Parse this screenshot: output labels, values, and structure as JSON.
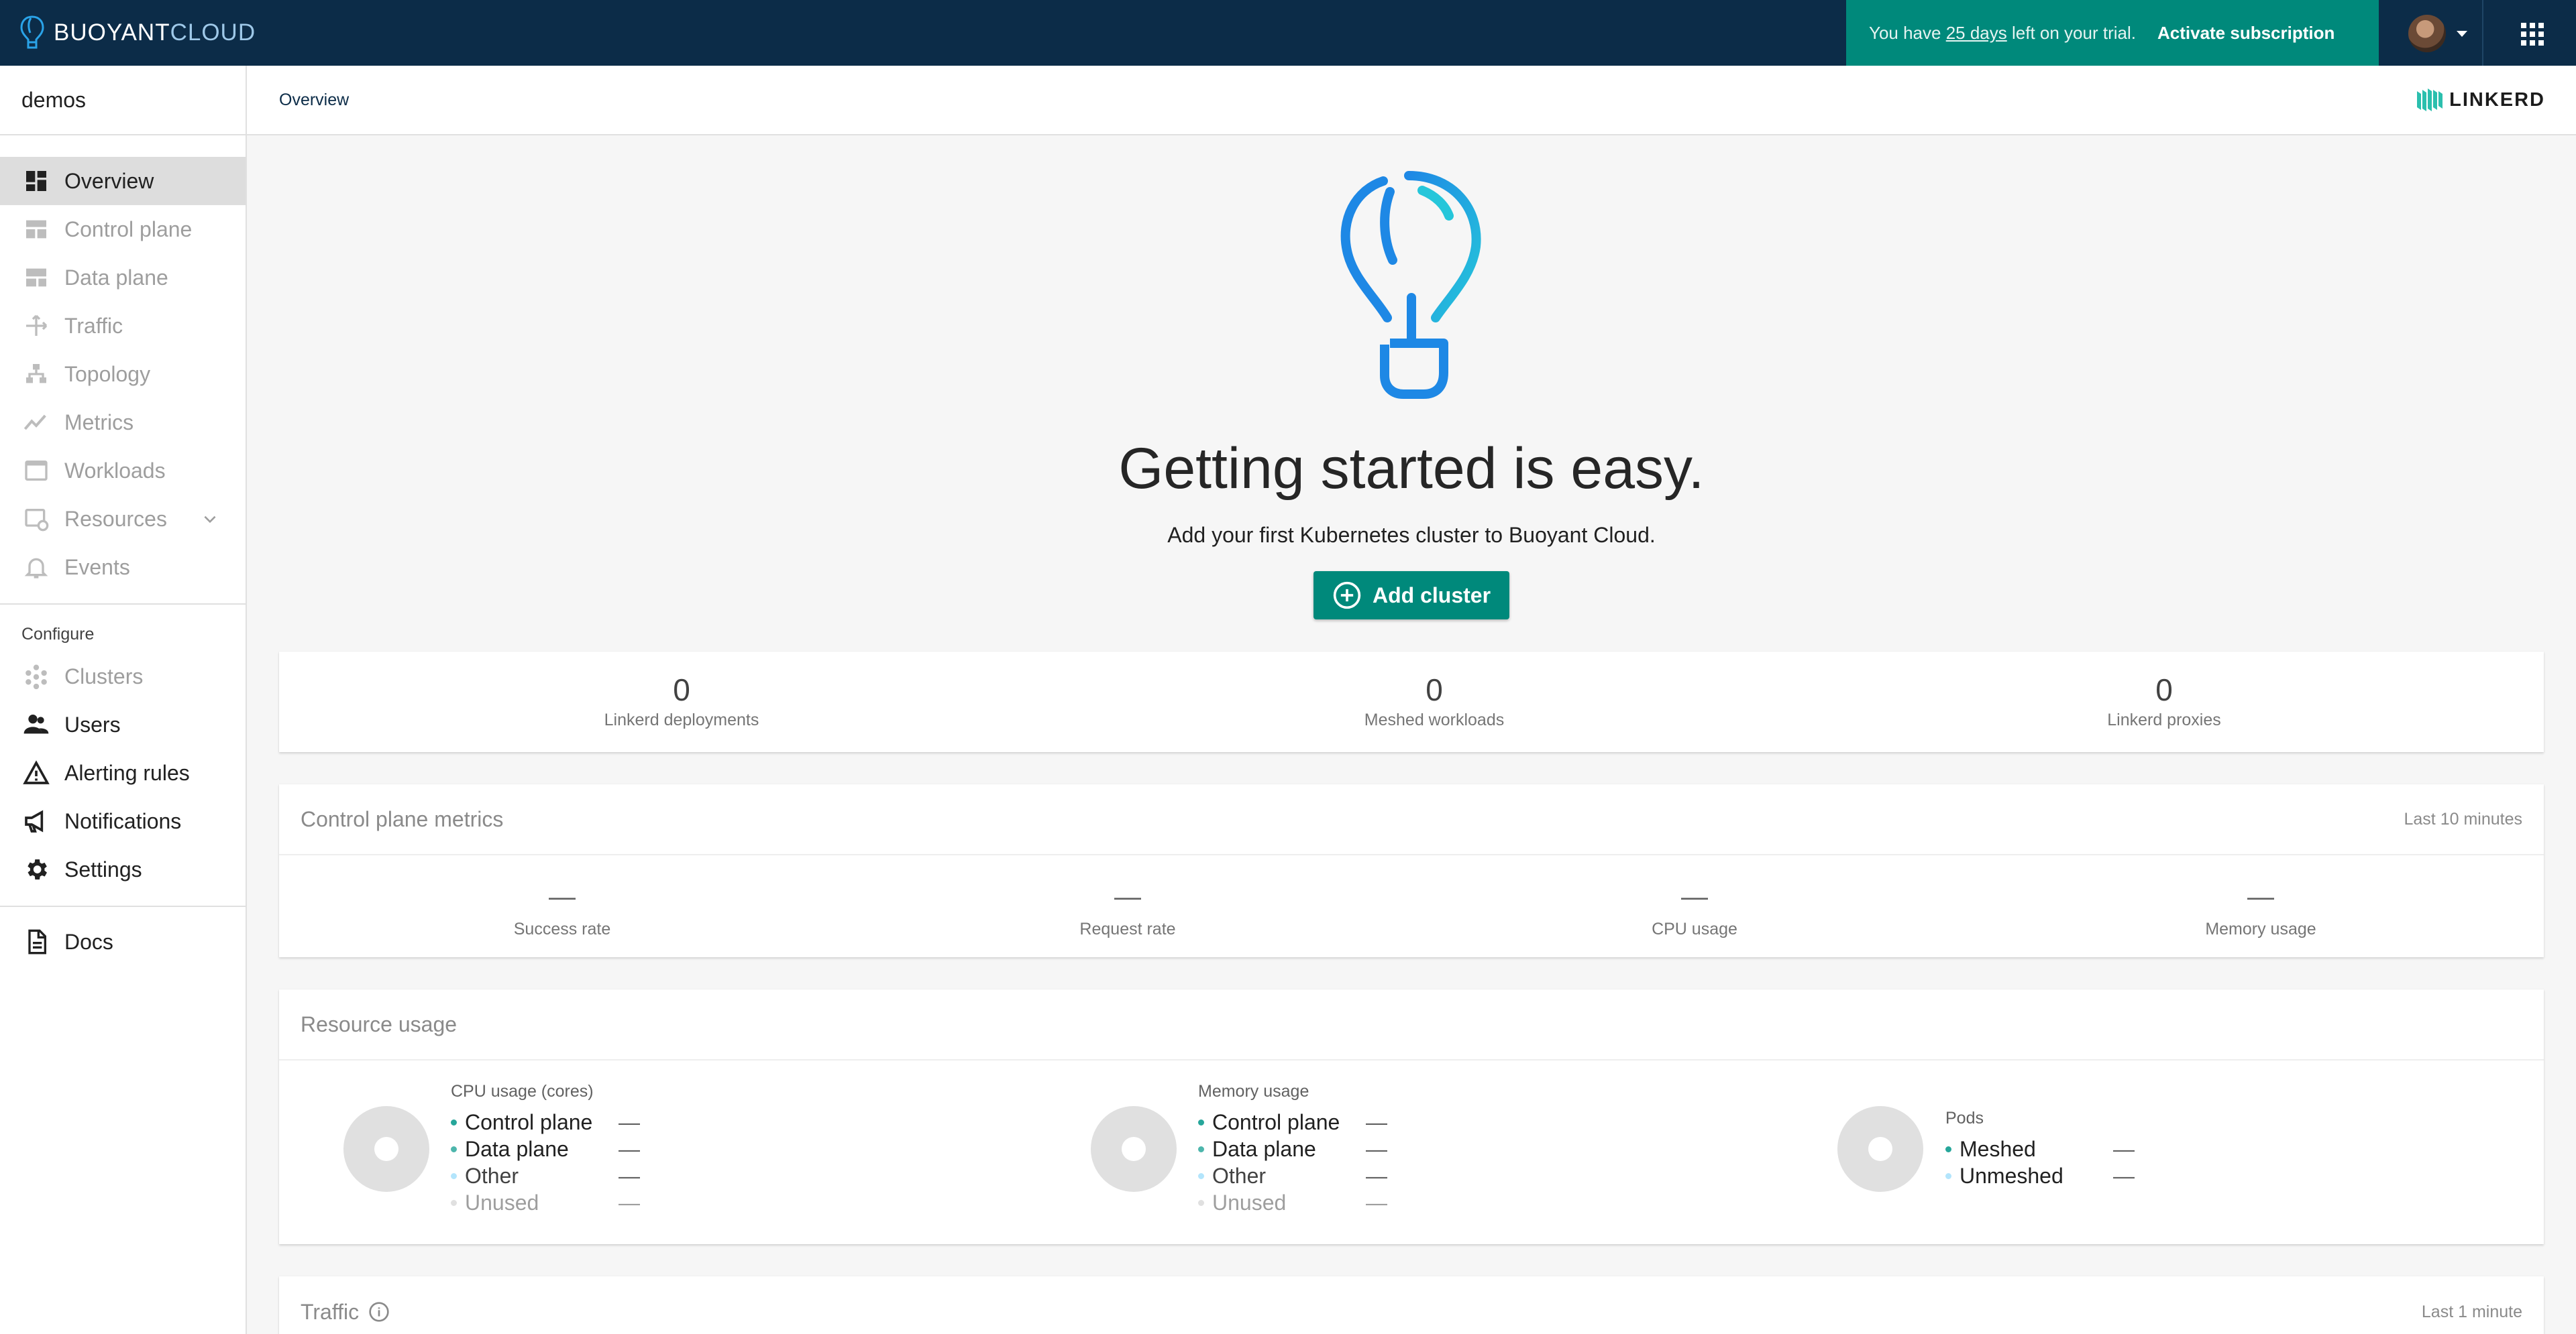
{
  "topbar": {
    "brand_primary": "BUOYANT",
    "brand_secondary": "CLOUD",
    "trial_prefix": "You have ",
    "trial_days": "25 days",
    "trial_suffix": " left on your trial.",
    "activate_label": "Activate subscription"
  },
  "sidebar": {
    "org_name": "demos",
    "items": [
      {
        "label": "Overview",
        "icon": "dashboard-icon"
      },
      {
        "label": "Control plane",
        "icon": "control-plane-icon"
      },
      {
        "label": "Data plane",
        "icon": "data-plane-icon"
      },
      {
        "label": "Traffic",
        "icon": "traffic-icon"
      },
      {
        "label": "Topology",
        "icon": "topology-icon"
      },
      {
        "label": "Metrics",
        "icon": "metrics-icon"
      },
      {
        "label": "Workloads",
        "icon": "workloads-icon"
      },
      {
        "label": "Resources",
        "icon": "resources-icon"
      },
      {
        "label": "Events",
        "icon": "bell-icon"
      }
    ],
    "configure_label": "Configure",
    "configure_items": [
      {
        "label": "Clusters",
        "icon": "clusters-icon"
      },
      {
        "label": "Users",
        "icon": "users-icon"
      },
      {
        "label": "Alerting rules",
        "icon": "warning-icon"
      },
      {
        "label": "Notifications",
        "icon": "megaphone-icon"
      },
      {
        "label": "Settings",
        "icon": "gear-icon"
      }
    ],
    "docs_label": "Docs"
  },
  "subheader": {
    "breadcrumb": "Overview",
    "linkerd_label": "LINKERD"
  },
  "hero": {
    "title": "Getting started is easy.",
    "subtitle": "Add your first Kubernetes cluster to Buoyant Cloud.",
    "add_cluster_label": "Add cluster"
  },
  "stats": [
    {
      "value": "0",
      "label": "Linkerd deployments"
    },
    {
      "value": "0",
      "label": "Meshed workloads"
    },
    {
      "value": "0",
      "label": "Linkerd proxies"
    }
  ],
  "control_plane_metrics": {
    "title": "Control plane metrics",
    "range": "Last 10 minutes",
    "metrics": [
      {
        "value": "—",
        "label": "Success rate"
      },
      {
        "value": "—",
        "label": "Request rate"
      },
      {
        "value": "—",
        "label": "CPU usage"
      },
      {
        "value": "—",
        "label": "Memory usage"
      }
    ]
  },
  "resource_usage": {
    "title": "Resource usage",
    "groups": [
      {
        "title": "CPU usage (cores)",
        "rows": [
          {
            "label": "Control plane",
            "value": "—",
            "color": "#26a69a"
          },
          {
            "label": "Data plane",
            "value": "—",
            "color": "#4db6ac"
          },
          {
            "label": "Other",
            "value": "—",
            "color": "#b3e5fc"
          },
          {
            "label": "Unused",
            "value": "—",
            "color": "#e0e0e0"
          }
        ]
      },
      {
        "title": "Memory usage",
        "rows": [
          {
            "label": "Control plane",
            "value": "—",
            "color": "#26a69a"
          },
          {
            "label": "Data plane",
            "value": "—",
            "color": "#4db6ac"
          },
          {
            "label": "Other",
            "value": "—",
            "color": "#b3e5fc"
          },
          {
            "label": "Unused",
            "value": "—",
            "color": "#e0e0e0"
          }
        ]
      },
      {
        "title": "Pods",
        "rows": [
          {
            "label": "Meshed",
            "value": "—",
            "color": "#26a69a"
          },
          {
            "label": "Unmeshed",
            "value": "—",
            "color": "#b3e5fc"
          }
        ]
      }
    ]
  },
  "traffic": {
    "title": "Traffic",
    "range": "Last 1 minute"
  },
  "colors": {
    "topbar": "#0c2c48",
    "accent": "#00897b",
    "sidebar_active": "#dddddd"
  }
}
